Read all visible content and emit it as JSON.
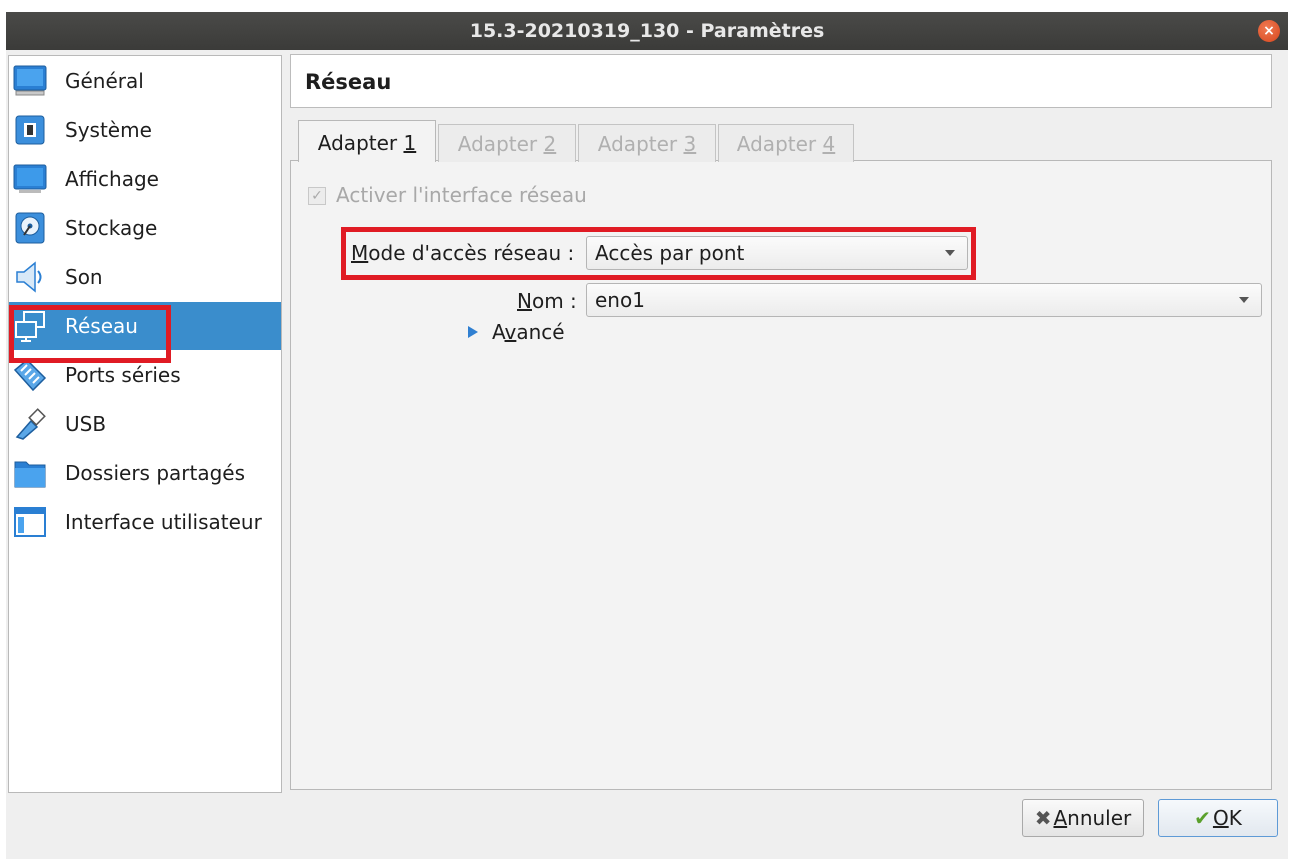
{
  "window": {
    "title": "15.3-20210319_130 - Paramètres",
    "close_glyph": "×"
  },
  "sidebar": {
    "items": [
      {
        "label": "Général",
        "icon": "monitor-icon"
      },
      {
        "label": "Système",
        "icon": "chip-icon"
      },
      {
        "label": "Affichage",
        "icon": "display-icon"
      },
      {
        "label": "Stockage",
        "icon": "disk-icon"
      },
      {
        "label": "Son",
        "icon": "speaker-icon"
      },
      {
        "label": "Réseau",
        "icon": "network-icon",
        "selected": true
      },
      {
        "label": "Ports séries",
        "icon": "serial-port-icon"
      },
      {
        "label": "USB",
        "icon": "usb-icon"
      },
      {
        "label": "Dossiers partagés",
        "icon": "folder-icon"
      },
      {
        "label": "Interface utilisateur",
        "icon": "window-icon"
      }
    ]
  },
  "page": {
    "title": "Réseau"
  },
  "tabs": [
    {
      "pre": "Adapter ",
      "key": "1",
      "active": true
    },
    {
      "pre": "Adapter ",
      "key": "2",
      "active": false
    },
    {
      "pre": "Adapter ",
      "key": "3",
      "active": false
    },
    {
      "pre": "Adapter ",
      "key": "4",
      "active": false
    }
  ],
  "adapter": {
    "enable_label": "Activer l'interface réseau",
    "enable_checked": true,
    "mode_label_key": "M",
    "mode_label_rest": "ode d'accès réseau :",
    "mode_value": "Accès par pont",
    "name_label_key": "N",
    "name_label_rest": "om :",
    "name_value": "eno1",
    "advanced_pre": "A",
    "advanced_key": "v",
    "advanced_rest": "ancé"
  },
  "buttons": {
    "cancel_glyph": "✖",
    "cancel_key": "A",
    "cancel_rest": "nnuler",
    "ok_glyph": "✔",
    "ok_key": "O",
    "ok_rest": "K"
  },
  "colors": {
    "selection": "#3a8dcc",
    "highlight": "#e01b24",
    "accent_blue": "#2f7fd1"
  }
}
